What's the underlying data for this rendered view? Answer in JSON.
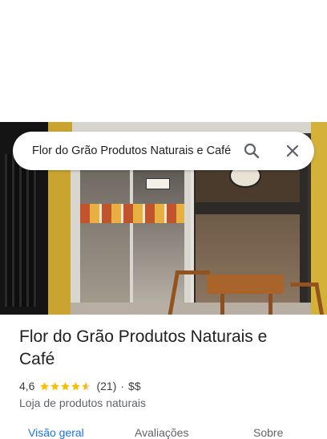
{
  "search": {
    "value": "Flor do Grão Produtos Naturais e Café"
  },
  "place": {
    "title": "Flor do Grão Produtos Naturais e Café",
    "rating": "4,6",
    "review_count": "(21)",
    "separator": "·",
    "price": "$$",
    "category": "Loja de produtos naturais",
    "star_fill": 4.6
  },
  "tabs": [
    {
      "label": "Visão geral",
      "active": true
    },
    {
      "label": "Avaliações",
      "active": false
    },
    {
      "label": "Sobre",
      "active": false
    }
  ],
  "icons": {
    "search": "search-icon",
    "close": "close-icon",
    "star": "star-icon"
  },
  "colors": {
    "star": "#fbbc04",
    "star_empty": "#dadce0",
    "accent": "#1a73e8",
    "text_primary": "#202124",
    "text_secondary": "#5f6368"
  }
}
